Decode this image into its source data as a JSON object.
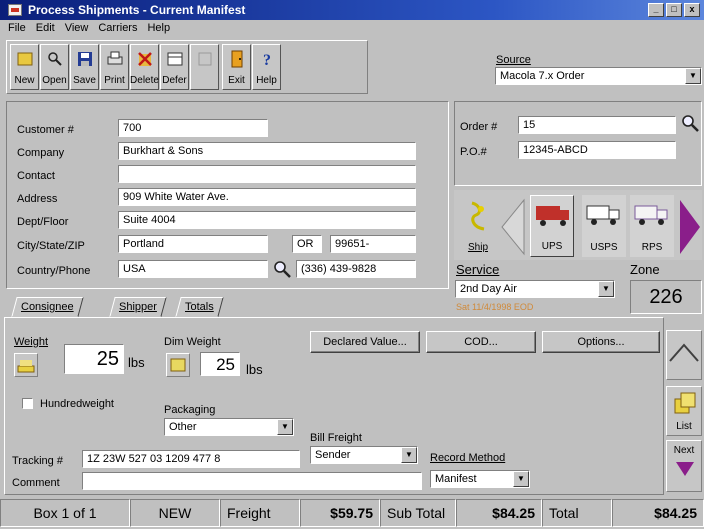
{
  "window": {
    "title": "Process Shipments - Current Manifest",
    "min": "_",
    "max": "□",
    "close": "x"
  },
  "menu": [
    "File",
    "Edit",
    "View",
    "Carriers",
    "Help"
  ],
  "toolbar": [
    {
      "label": "New",
      "icon": "new-icon"
    },
    {
      "label": "Open",
      "icon": "open-icon"
    },
    {
      "label": "Save",
      "icon": "save-icon"
    },
    {
      "label": "Print",
      "icon": "print-icon"
    },
    {
      "label": "Delete",
      "icon": "delete-icon"
    },
    {
      "label": "Defer",
      "icon": "defer-icon"
    },
    {
      "label": "",
      "icon": "disabled-icon"
    },
    {
      "label": "Exit",
      "icon": "exit-icon"
    },
    {
      "label": "Help",
      "icon": "help-icon"
    }
  ],
  "source": {
    "label": "Source",
    "value": "Macola 7.x Order"
  },
  "customer": {
    "customer_label": "Customer #",
    "customer": "700",
    "company_label": "Company",
    "company": "Burkhart & Sons",
    "contact_label": "Contact",
    "contact": "",
    "address_label": "Address",
    "address": "909 White Water Ave.",
    "dept_label": "Dept/Floor",
    "dept": "Suite 4004",
    "city_label": "City/State/ZIP",
    "city": "Portland",
    "state": "OR",
    "zip": "99651-",
    "country_label": "Country/Phone",
    "country": "USA",
    "phone": "(336) 439-9828"
  },
  "order": {
    "order_label": "Order #",
    "order": "15",
    "po_label": "P.O.#",
    "po": "12345-ABCD"
  },
  "carriers": [
    {
      "label": "Ship"
    },
    {
      "label": "UPS"
    },
    {
      "label": "USPS"
    },
    {
      "label": "RPS"
    }
  ],
  "service": {
    "label": "Service",
    "value": "2nd Day Air",
    "subtext": "Sat 11/4/1998 EOD",
    "zone_label": "Zone",
    "zone": "226"
  },
  "tabs": [
    "Consignee",
    "Shipper",
    "Totals"
  ],
  "package": {
    "weight_label": "Weight",
    "weight": "25",
    "weight_unit": "lbs",
    "dim_label": "Dim Weight",
    "dim": "25",
    "dim_unit": "lbs",
    "declared_btn": "Declared Value...",
    "cod_btn": "COD...",
    "options_btn": "Options...",
    "hundred_label": "Hundredweight",
    "packaging_label": "Packaging",
    "packaging": "Other",
    "bill_label": "Bill Freight",
    "bill": "Sender",
    "record_label": "Record Method",
    "record": "Manifest",
    "tracking_label": "Tracking #",
    "tracking": "1Z 23W 527 03 1209 477 8",
    "comment_label": "Comment",
    "comment": ""
  },
  "side": {
    "list": "List",
    "next": "Next"
  },
  "status": {
    "box": "Box 1 of 1",
    "state": "NEW",
    "freight_label": "Freight",
    "freight": "$59.75",
    "subtotal_label": "Sub Total",
    "subtotal": "$84.25",
    "total_label": "Total",
    "total": "$84.25"
  },
  "colors": {
    "title": "#0a1e7a",
    "accent_purple": "#8a1e8a",
    "truck_red": "#c0302a"
  }
}
